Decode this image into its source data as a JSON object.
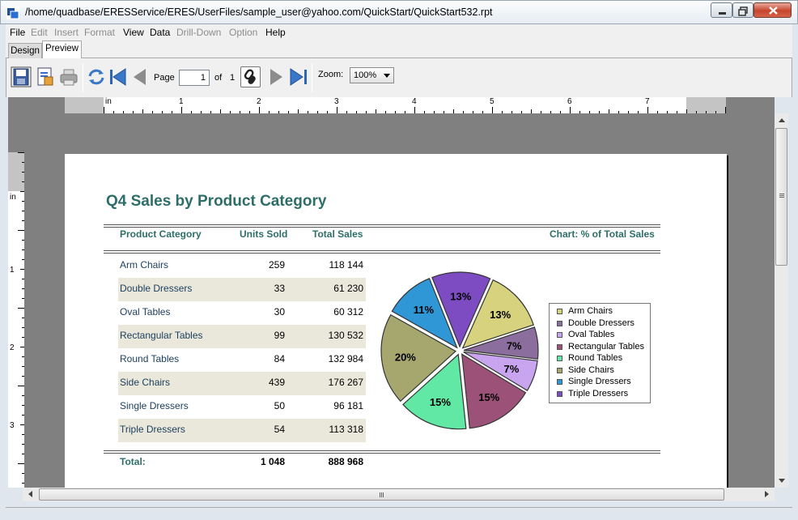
{
  "window": {
    "title": "/home/quadbase/ERESService/ERES/UserFiles/sample_user@yahoo.com/QuickStart/QuickStart532.rpt"
  },
  "menu": [
    {
      "label": "File",
      "enabled": true
    },
    {
      "label": "Edit",
      "enabled": false
    },
    {
      "label": "Insert",
      "enabled": false
    },
    {
      "label": "Format",
      "enabled": false
    },
    {
      "label": "View",
      "enabled": true
    },
    {
      "label": "Data",
      "enabled": true
    },
    {
      "label": "Drill-Down",
      "enabled": false
    },
    {
      "label": "Option",
      "enabled": false
    },
    {
      "label": "Help",
      "enabled": true
    }
  ],
  "tabs": {
    "design": "Design",
    "preview": "Preview",
    "active": "Preview"
  },
  "toolbar": {
    "page_label": "Page",
    "page_value": "1",
    "of_label": "of",
    "page_count": "1",
    "zoom_label": "Zoom:",
    "zoom_value": "100%"
  },
  "ruler": {
    "unit": "in",
    "h_numbers": [
      "1",
      "2",
      "3",
      "4",
      "5",
      "6",
      "7"
    ],
    "v_numbers": [
      "1",
      "2",
      "3"
    ]
  },
  "report": {
    "title": "Q4 Sales by Product Category",
    "headers": {
      "category": "Product Category",
      "units": "Units Sold",
      "sales": "Total Sales",
      "chart": "Chart: % of Total Sales"
    },
    "rows": [
      {
        "category": "Arm Chairs",
        "units": "259",
        "sales": "118 144"
      },
      {
        "category": "Double Dressers",
        "units": "33",
        "sales": "61 230"
      },
      {
        "category": "Oval Tables",
        "units": "30",
        "sales": "60 312"
      },
      {
        "category": "Rectangular Tables",
        "units": "99",
        "sales": "130 532"
      },
      {
        "category": "Round Tables",
        "units": "84",
        "sales": "132 984"
      },
      {
        "category": "Side Chairs",
        "units": "439",
        "sales": "176 267"
      },
      {
        "category": "Single Dressers",
        "units": "50",
        "sales": "96 181"
      },
      {
        "category": "Triple Dressers",
        "units": "54",
        "sales": "113 318"
      }
    ],
    "total": {
      "label": "Total:",
      "units": "1 048",
      "sales": "888 968"
    }
  },
  "chart_data": {
    "type": "pie",
    "title": "Chart: % of Total Sales",
    "categories": [
      "Arm Chairs",
      "Double Dressers",
      "Oval Tables",
      "Rectangular Tables",
      "Round Tables",
      "Side Chairs",
      "Single Dressers",
      "Triple Dressers"
    ],
    "values": [
      118144,
      61230,
      60312,
      130532,
      132984,
      176267,
      96181,
      113318
    ],
    "labels": [
      "13%",
      "7%",
      "7%",
      "15%",
      "15%",
      "20%",
      "11%",
      "13%"
    ],
    "colors": [
      "#d7d27e",
      "#8c6e9e",
      "#c8a5ee",
      "#9c5278",
      "#60e8a4",
      "#a6a76e",
      "#3097d7",
      "#7d4bc2"
    ],
    "legend_position": "right"
  }
}
